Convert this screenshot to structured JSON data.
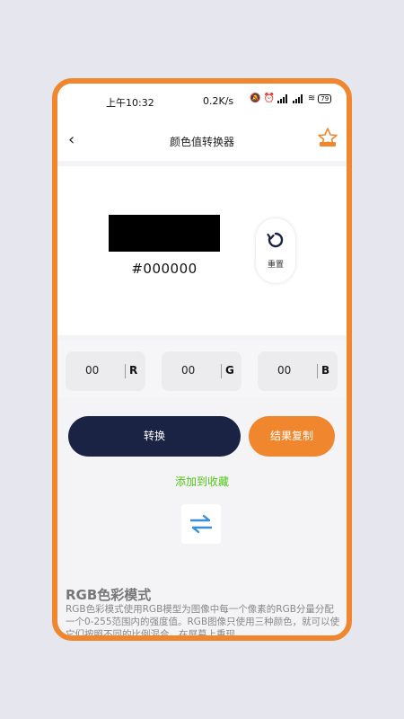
{
  "status_bar": {
    "time": "上午10:32",
    "net_speed": "0.2K/s",
    "battery": "79"
  },
  "nav": {
    "title": "颜色值转换器",
    "back_glyph": "‹"
  },
  "preview": {
    "swatch_color": "#000000",
    "hex_value": "#000000",
    "reset_label": "重置"
  },
  "rgb": [
    {
      "value": "00",
      "channel": "R"
    },
    {
      "value": "00",
      "channel": "G"
    },
    {
      "value": "00",
      "channel": "B"
    }
  ],
  "actions": {
    "convert_label": "转换",
    "copy_label": "结果复制",
    "add_fav_label": "添加到收藏"
  },
  "info": {
    "title": "RGB色彩模式",
    "body": " RGB色彩模式使用RGB模型为图像中每一个像素的RGB分量分配一个0-255范围内的强度值。RGB图像只使用三种颜色，就可以使它们按照不同的比例混合，在屏幕上重现"
  },
  "colors": {
    "accent": "#f0872f",
    "primary": "#1a2344",
    "success": "#52c41a",
    "reset_icon": "#1a2344",
    "swap_icon": "#3b8ed8"
  }
}
